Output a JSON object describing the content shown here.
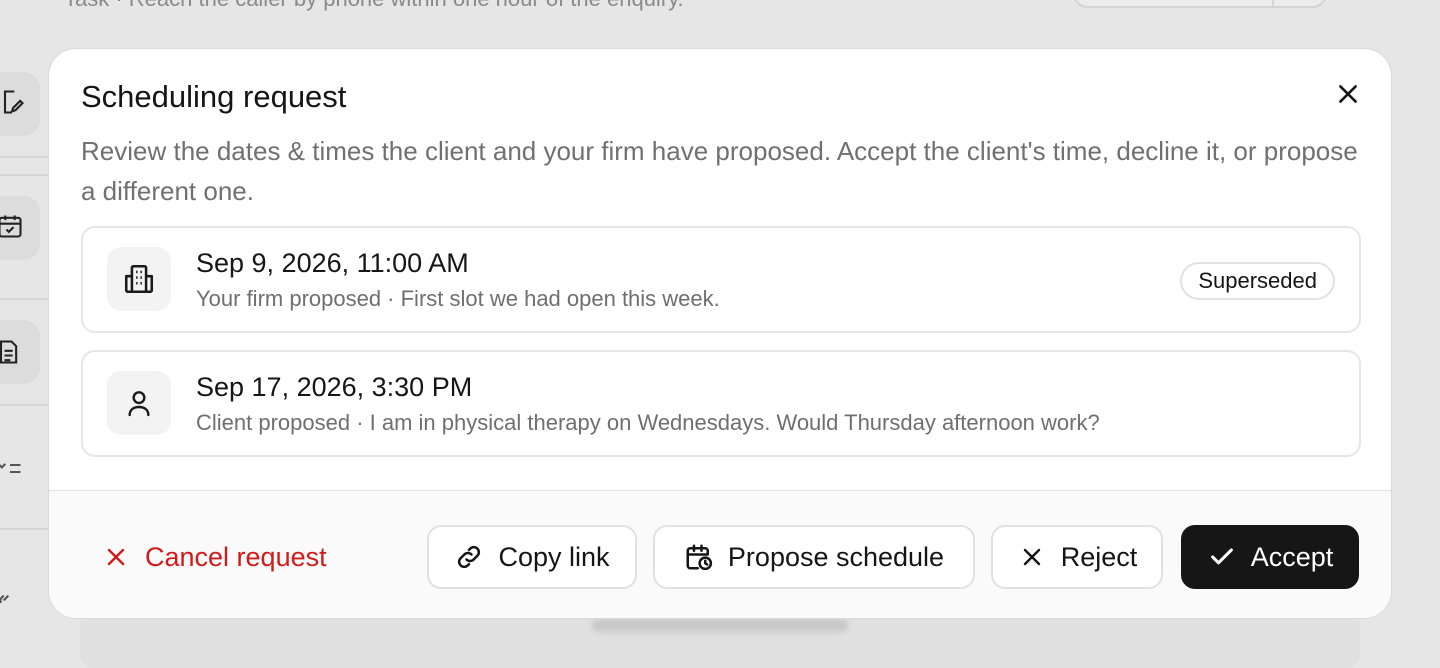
{
  "background": {
    "top_text": "Task · Reach the caller by phone within one hour of the enquiry."
  },
  "dialog": {
    "title": "Scheduling request",
    "description": "Review the dates & times the client and your firm have proposed. Accept the client's time, decline it, or propose a different one.",
    "close_icon": "close-icon",
    "slots": [
      {
        "icon": "building-icon",
        "when": "Sep 9, 2026, 11:00 AM",
        "meta": "Your firm proposed · First slot we had open this week.",
        "badge": "Superseded"
      },
      {
        "icon": "person-icon",
        "when": "Sep 17, 2026, 3:30 PM",
        "meta": "Client proposed · I am in physical therapy on Wednesdays. Would Thursday afternoon work?",
        "badge": ""
      }
    ]
  },
  "footer": {
    "cancel_label": "Cancel request",
    "copy_label": "Copy link",
    "propose_label": "Propose schedule",
    "reject_label": "Reject",
    "accept_label": "Accept"
  },
  "colors": {
    "danger": "#d21a1a",
    "primary": "#161616",
    "muted_text": "#707070",
    "border": "#e1e1e1"
  }
}
